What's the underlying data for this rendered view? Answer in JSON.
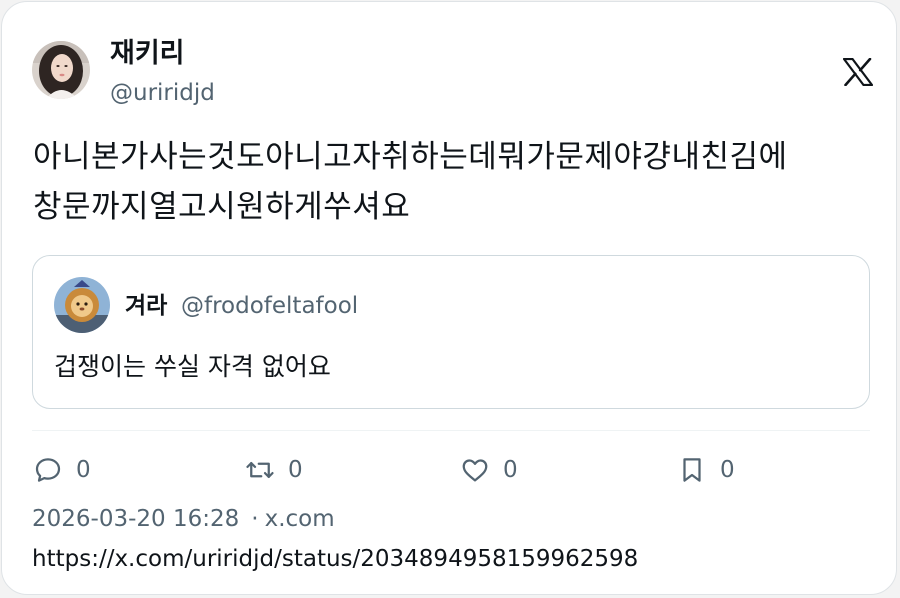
{
  "author": {
    "display_name": "재키리",
    "handle": "@uriridjd",
    "avatar_icon": "profile-photo"
  },
  "brand": {
    "logo_icon": "x-logo-icon"
  },
  "tweet": {
    "line1": "아니본가사는것도아니고자취하는데뭐가문제야걍내친김에",
    "line2": "창문까지열고시원하게쑤셔요"
  },
  "quoted": {
    "display_name": "겨라",
    "handle": "@frodofeltafool",
    "text": "겁쟁이는 쑤실 자격 없어요",
    "avatar_icon": "cartoon-lion-avatar"
  },
  "actions": {
    "reply_count": "0",
    "retweet_count": "0",
    "like_count": "0",
    "bookmark_count": "0"
  },
  "meta": {
    "timestamp": "2026-03-20 16:28",
    "separator": "·",
    "source": "x.com"
  },
  "url": "https://x.com/uriridjd/status/2034894958159962598",
  "colors": {
    "text_primary": "#0f1419",
    "text_secondary": "#536471",
    "border": "#cfd9de"
  }
}
